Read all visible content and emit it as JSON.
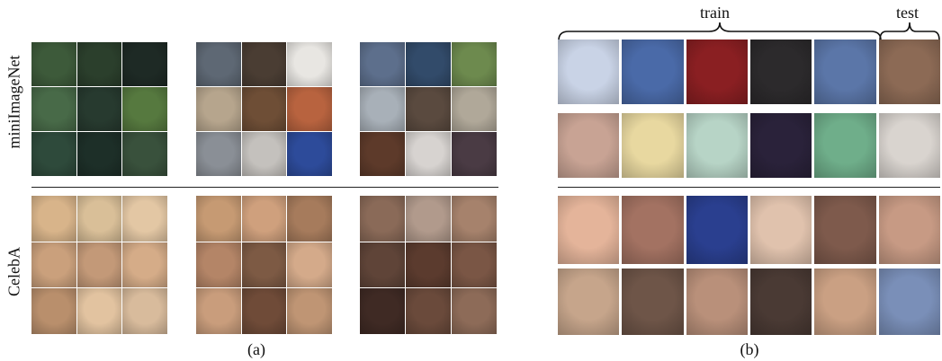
{
  "panel_a": {
    "row_labels": [
      "miniImageNet",
      "CelebA"
    ],
    "caption": "(a)"
  },
  "panel_b": {
    "brace_labels": [
      "train",
      "test"
    ],
    "caption": "(b)"
  },
  "colors": {
    "fish": [
      "#3d5a3a",
      "#2b3f2c",
      "#1e2a25",
      "#486a48",
      "#273a2f",
      "#56793f",
      "#2e4a3b",
      "#1d2f28",
      "#39513c"
    ],
    "bells_shoes_bottles": [
      "#5e6874",
      "#4a3d33",
      "#e8e6e2",
      "#b6a58d",
      "#6e4e36",
      "#b8633f",
      "#8a8f96",
      "#c4c1bd",
      "#2d4b9a"
    ],
    "ships_misc": [
      "#5d6f8c",
      "#324b6a",
      "#6d8a4e",
      "#a8b0b8",
      "#5a4a3f",
      "#b0a899",
      "#5d3a2a",
      "#d7d3d0",
      "#4a3b44"
    ],
    "celeb_blonde": [
      "#d8b48a",
      "#d9bf98",
      "#e3c7a4",
      "#caa07c",
      "#c39978",
      "#d5ac88",
      "#b98f6c",
      "#e2c3a0",
      "#d8bb9c"
    ],
    "celeb_caps": [
      "#c69a73",
      "#cfa07d",
      "#a67b5c",
      "#b48567",
      "#7d5a44",
      "#d4aa8a",
      "#c99d7c",
      "#6f4b38",
      "#bf9574"
    ],
    "celeb_men": [
      "#8a6a58",
      "#b19a8c",
      "#a6826c",
      "#5f4438",
      "#5b3b2e",
      "#7a5645",
      "#3f2a24",
      "#6a4a3b",
      "#8d6b58"
    ],
    "vases": [
      "#c9d3e6",
      "#4a6aa8",
      "#8a1f22",
      "#2c2a2c",
      "#5b76a8",
      "#8c6a55"
    ],
    "bowls": [
      "#c8a394",
      "#e8d8a0",
      "#b7d4c6",
      "#2a223a",
      "#6fae8a",
      "#d9d4cf"
    ],
    "faces1": [
      "#e4b49a",
      "#a37262",
      "#2a3f8f",
      "#e0c2ad",
      "#7e5a4c",
      "#c79a84"
    ],
    "faces2": [
      "#c6a58b",
      "#6e5548",
      "#b9907a",
      "#4a3a34",
      "#caa083",
      "#7a8fb8"
    ]
  }
}
